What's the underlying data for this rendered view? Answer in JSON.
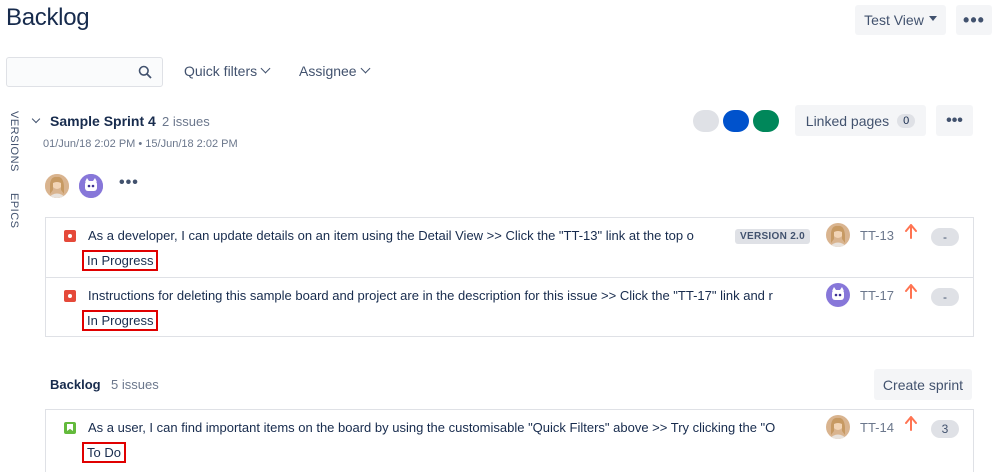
{
  "page": {
    "title": "Backlog"
  },
  "header": {
    "view_label": "Test View"
  },
  "filters": {
    "search_placeholder": "",
    "quick_filters_label": "Quick filters",
    "assignee_label": "Assignee"
  },
  "side_tabs": {
    "versions": "VERSIONS",
    "epics": "EPICS"
  },
  "sprint": {
    "name": "Sample Sprint 4",
    "issue_count": "2 issues",
    "dates": "01/Jun/18 2:02 PM  •  15/Jun/18 2:02 PM",
    "status_colors": [
      "#dfe1e6",
      "#0052cc",
      "#00875a"
    ],
    "linked_pages_label": "Linked pages",
    "linked_pages_count": "0",
    "issues": [
      {
        "type": "bug",
        "summary": "As a developer, I can update details on an item using the Detail View >> Click the \"TT-13\" link at the top o",
        "version": "VERSION 2.0",
        "status": "In Progress",
        "assignee_icon": "avatar-woman-icon",
        "key": "TT-13",
        "priority": "high",
        "estimate": "-"
      },
      {
        "type": "bug",
        "summary": "Instructions for deleting this sample board and project are in the description for this issue >> Click the \"TT-17\" link and r",
        "status": "In Progress",
        "assignee_icon": "avatar-robot-icon",
        "key": "TT-17",
        "priority": "high",
        "estimate": "-"
      }
    ]
  },
  "backlog": {
    "name": "Backlog",
    "issue_count": "5 issues",
    "create_sprint_label": "Create sprint",
    "issues": [
      {
        "type": "story",
        "summary": "As a user, I can find important items on the board by using the customisable \"Quick Filters\" above >> Try clicking the \"O",
        "status": "To Do",
        "assignee_icon": "avatar-woman-icon",
        "key": "TT-14",
        "priority": "high",
        "estimate": "3"
      }
    ]
  }
}
